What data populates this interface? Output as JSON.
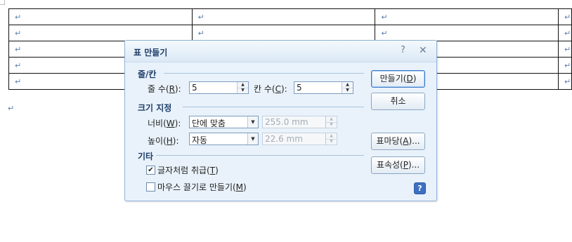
{
  "document": {
    "para_mark": "↵",
    "rows": [
      [
        "↵",
        "↵",
        "↵",
        "↵"
      ],
      [
        "↵",
        "↵",
        "↵",
        "↵"
      ],
      [
        "↵",
        "↵",
        "↵",
        "↵"
      ],
      [
        "↵",
        "↵",
        "↵",
        "↵"
      ],
      [
        "↵",
        "↵",
        "↵",
        "↵"
      ]
    ]
  },
  "dialog": {
    "title": "표 만들기",
    "help_icon": "?",
    "close_icon": "✕",
    "rows_cols_section": "줄/칸",
    "rows": {
      "label_prefix": "줄 수(",
      "mnemonic": "R",
      "label_suffix": "):",
      "value": "5"
    },
    "cols": {
      "label_prefix": "칸 수(",
      "mnemonic": "C",
      "label_suffix": "):",
      "value": "5"
    },
    "size_section": "크기 지정",
    "width": {
      "label_prefix": "너비(",
      "mnemonic": "W",
      "label_suffix": "):",
      "option": "단에 맞춤",
      "value": "255.0 mm"
    },
    "height": {
      "label_prefix": "높이(",
      "mnemonic": "H",
      "label_suffix": "):",
      "option": "자동",
      "value": "22.6 mm"
    },
    "other_section": "기타",
    "treat_as_char": {
      "label_prefix": "글자처럼 취급(",
      "mnemonic": "T",
      "label_suffix": ")",
      "checked": true
    },
    "mouse_drag": {
      "label_prefix": "마우스 끌기로 만들기(",
      "mnemonic": "M",
      "label_suffix": ")",
      "checked": false
    },
    "buttons": {
      "create": {
        "prefix": "만들기(",
        "mnemonic": "D",
        "suffix": ")"
      },
      "cancel": "취소",
      "table_style": {
        "prefix": "표마당(",
        "mnemonic": "A",
        "suffix": ")..."
      },
      "table_props": {
        "prefix": "표속성(",
        "mnemonic": "P",
        "suffix": ")..."
      }
    },
    "help_button": "?"
  }
}
